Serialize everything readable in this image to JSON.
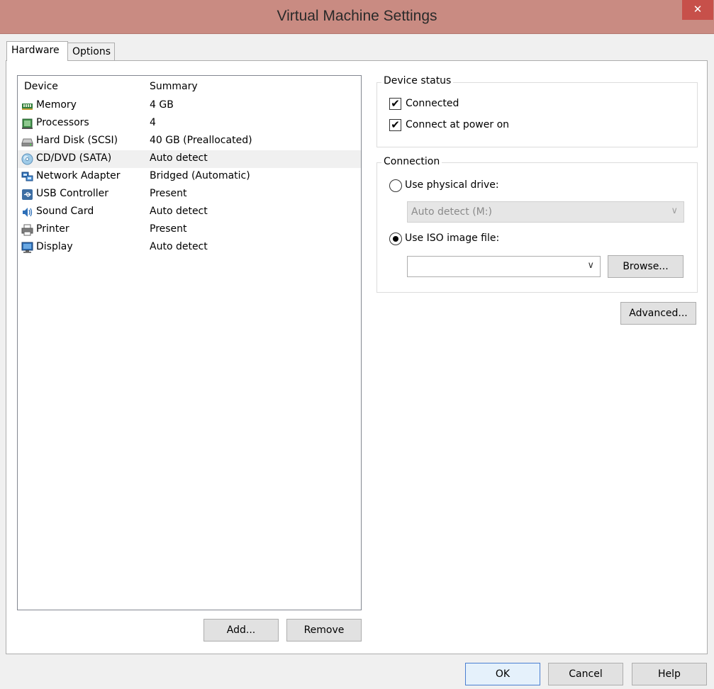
{
  "window": {
    "title": "Virtual Machine Settings",
    "close_glyph": "✕"
  },
  "tabs": [
    {
      "label": "Hardware",
      "active": true
    },
    {
      "label": "Options",
      "active": false
    }
  ],
  "device_list": {
    "headers": {
      "device": "Device",
      "summary": "Summary"
    },
    "rows": [
      {
        "name": "Memory",
        "summary": "4 GB",
        "icon": "memory-icon"
      },
      {
        "name": "Processors",
        "summary": "4",
        "icon": "processor-icon"
      },
      {
        "name": "Hard Disk (SCSI)",
        "summary": "40 GB (Preallocated)",
        "icon": "hard-disk-icon"
      },
      {
        "name": "CD/DVD (SATA)",
        "summary": "Auto detect",
        "icon": "cd-dvd-icon",
        "selected": true
      },
      {
        "name": "Network Adapter",
        "summary": "Bridged (Automatic)",
        "icon": "network-adapter-icon"
      },
      {
        "name": "USB Controller",
        "summary": "Present",
        "icon": "usb-icon"
      },
      {
        "name": "Sound Card",
        "summary": "Auto detect",
        "icon": "sound-card-icon"
      },
      {
        "name": "Printer",
        "summary": "Present",
        "icon": "printer-icon"
      },
      {
        "name": "Display",
        "summary": "Auto detect",
        "icon": "display-icon"
      }
    ],
    "add_label": "Add...",
    "remove_label": "Remove"
  },
  "device_status": {
    "title": "Device status",
    "connected_label": "Connected",
    "connected_checked": true,
    "power_on_label": "Connect at power on",
    "power_on_checked": true,
    "check_glyph": "✔"
  },
  "connection": {
    "title": "Connection",
    "physical_label": "Use physical drive:",
    "physical_value": "Auto detect (M:)",
    "iso_label": "Use ISO image file:",
    "iso_value": "",
    "browse_label": "Browse...",
    "selected_option": "iso",
    "chevron_glyph": "∨"
  },
  "advanced_label": "Advanced...",
  "footer": {
    "ok_label": "OK",
    "cancel_label": "Cancel",
    "help_label": "Help"
  },
  "colors": {
    "titlebar": "#c98b82",
    "close_button": "#c7504a",
    "selected_row": "#f0f0f0",
    "default_button_border": "#4a7fd1"
  }
}
